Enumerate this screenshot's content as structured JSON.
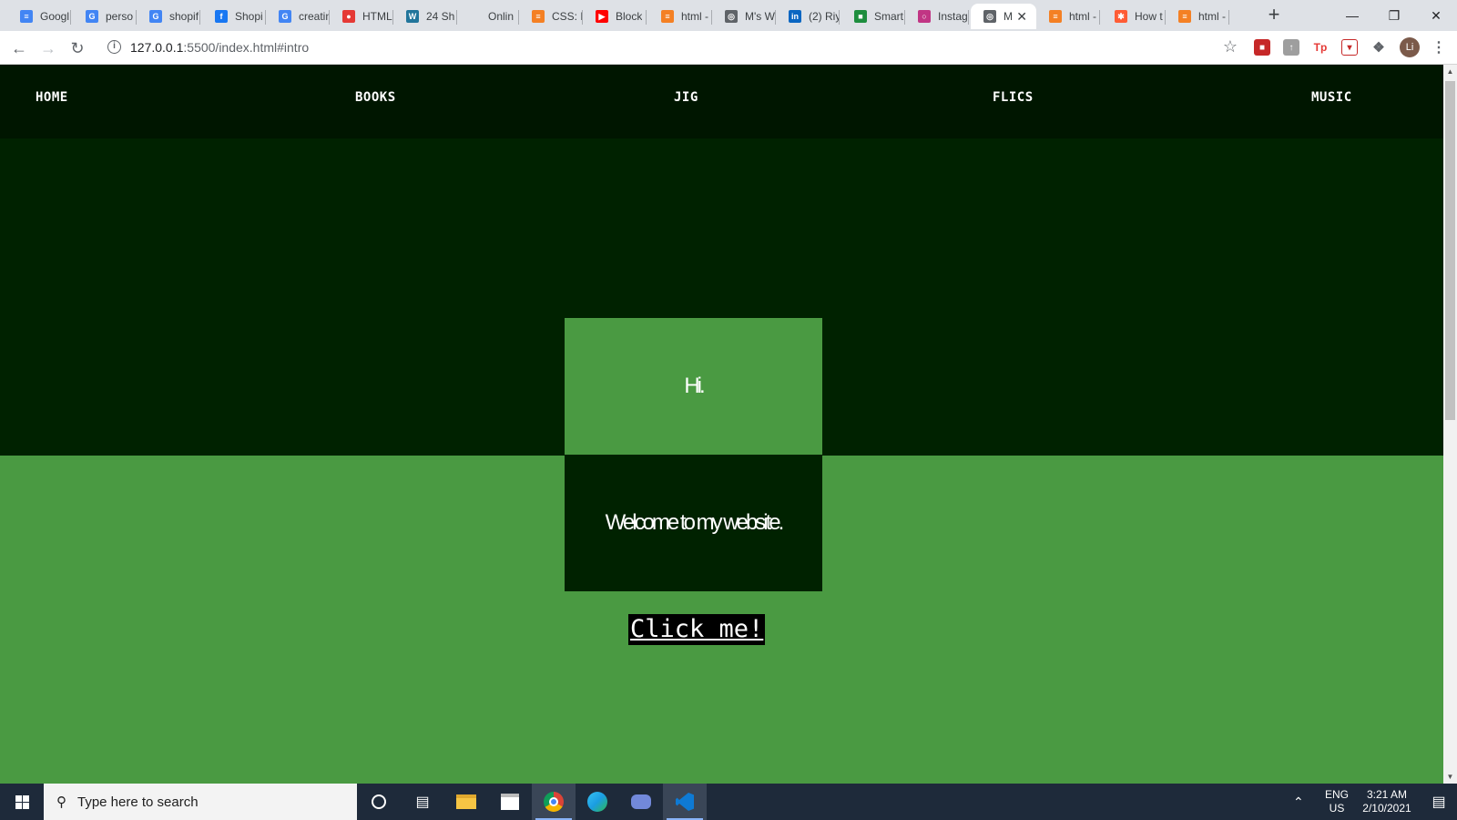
{
  "browser": {
    "tabs": [
      {
        "label": "Googl",
        "favicon": "google-docs-icon",
        "color": "#4285f4"
      },
      {
        "label": "perso",
        "favicon": "google-icon",
        "color": "#4285f4"
      },
      {
        "label": "shopif",
        "favicon": "google-icon",
        "color": "#4285f4"
      },
      {
        "label": "Shopi",
        "favicon": "facebook-icon",
        "color": "#1877f2"
      },
      {
        "label": "creatin",
        "favicon": "google-icon",
        "color": "#4285f4"
      },
      {
        "label": "HTML",
        "favicon": "record-icon",
        "color": "#e53935"
      },
      {
        "label": "24 Sh",
        "favicon": "wordpress-icon",
        "color": "#21759b"
      },
      {
        "label": "Onlin",
        "favicon": "blank-icon",
        "color": "#dee1e6"
      },
      {
        "label": "CSS: H",
        "favicon": "stackoverflow-icon",
        "color": "#f48024"
      },
      {
        "label": "Block",
        "favicon": "youtube-icon",
        "color": "#ff0000"
      },
      {
        "label": "html -",
        "favicon": "stackoverflow-icon",
        "color": "#f48024"
      },
      {
        "label": "M's W",
        "favicon": "globe-icon",
        "color": "#5f6368"
      },
      {
        "label": "(2) Riy",
        "favicon": "linkedin-icon",
        "color": "#0a66c2"
      },
      {
        "label": "Smart",
        "favicon": "car-icon",
        "color": "#1e8e3e"
      },
      {
        "label": "Instag",
        "favicon": "instagram-icon",
        "color": "#c13584"
      },
      {
        "label": "M",
        "favicon": "globe-icon",
        "color": "#5f6368",
        "active": true
      },
      {
        "label": "html -",
        "favicon": "stackoverflow-icon",
        "color": "#f48024"
      },
      {
        "label": "How t",
        "favicon": "hubspot-icon",
        "color": "#ff5c35"
      },
      {
        "label": "html -",
        "favicon": "stackoverflow-icon",
        "color": "#f48024"
      }
    ],
    "address_host": "127.0.0.1",
    "address_rest": ":5500/index.html#intro"
  },
  "site": {
    "nav": [
      "HOME",
      "BOOKS",
      "JIG",
      "FLICS",
      "MUSIC"
    ],
    "hi_text": "Hi.",
    "welcome_text": "Welcome to my website.",
    "button_label": "Click me!",
    "colors": {
      "nav_bg": "#001600",
      "dark_green": "#002200",
      "light_green": "#4a9a42"
    }
  },
  "taskbar": {
    "search_placeholder": "Type here to search",
    "lang_line1": "ENG",
    "lang_line2": "US",
    "time": "3:21 AM",
    "date": "2/10/2021"
  }
}
